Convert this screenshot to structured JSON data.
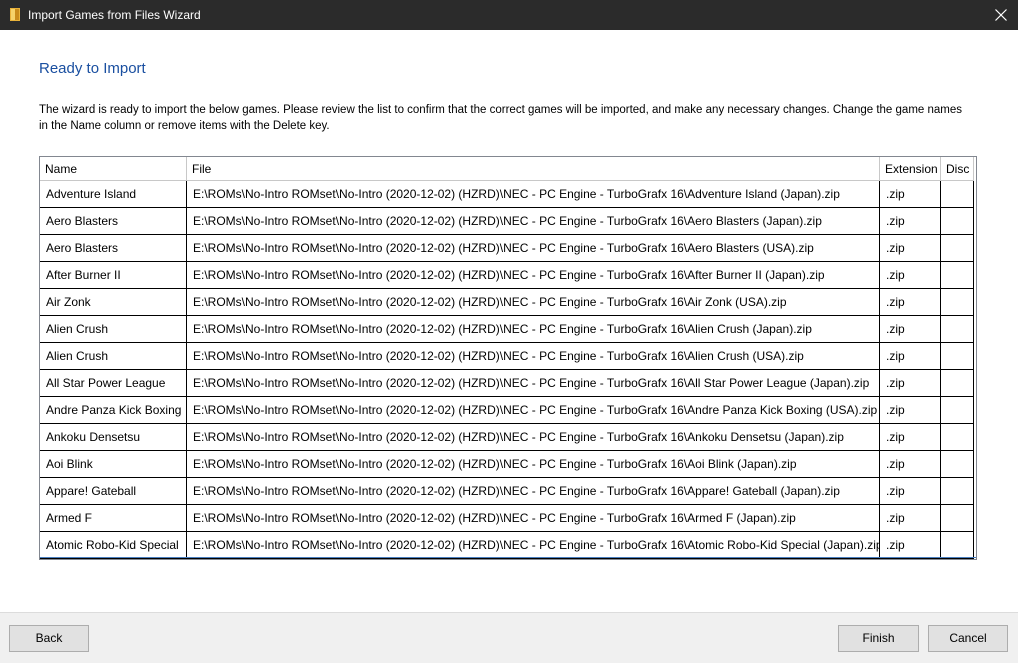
{
  "window": {
    "title": "Import Games from Files Wizard",
    "icon": "folder-icon",
    "close_icon": "close-icon"
  },
  "page": {
    "heading": "Ready to Import",
    "instructions": "The wizard is ready to import the below games. Please review the list to confirm that the correct games will be imported, and make any necessary changes. Change the game names in the Name column or remove items with the Delete key."
  },
  "table": {
    "columns": [
      "Name",
      "File",
      "Extension",
      "Disc"
    ],
    "rows": [
      {
        "name": "Adventure Island",
        "file": "E:\\ROMs\\No-Intro ROMset\\No-Intro (2020-12-02) (HZRD)\\NEC - PC Engine - TurboGrafx 16\\Adventure Island (Japan).zip",
        "ext": ".zip",
        "disc": ""
      },
      {
        "name": "Aero Blasters",
        "file": "E:\\ROMs\\No-Intro ROMset\\No-Intro (2020-12-02) (HZRD)\\NEC - PC Engine - TurboGrafx 16\\Aero Blasters (Japan).zip",
        "ext": ".zip",
        "disc": ""
      },
      {
        "name": "Aero Blasters",
        "file": "E:\\ROMs\\No-Intro ROMset\\No-Intro (2020-12-02) (HZRD)\\NEC - PC Engine - TurboGrafx 16\\Aero Blasters (USA).zip",
        "ext": ".zip",
        "disc": ""
      },
      {
        "name": "After Burner II",
        "file": "E:\\ROMs\\No-Intro ROMset\\No-Intro (2020-12-02) (HZRD)\\NEC - PC Engine - TurboGrafx 16\\After Burner II (Japan).zip",
        "ext": ".zip",
        "disc": ""
      },
      {
        "name": "Air Zonk",
        "file": "E:\\ROMs\\No-Intro ROMset\\No-Intro (2020-12-02) (HZRD)\\NEC - PC Engine - TurboGrafx 16\\Air Zonk (USA).zip",
        "ext": ".zip",
        "disc": ""
      },
      {
        "name": "Alien Crush",
        "file": "E:\\ROMs\\No-Intro ROMset\\No-Intro (2020-12-02) (HZRD)\\NEC - PC Engine - TurboGrafx 16\\Alien Crush (Japan).zip",
        "ext": ".zip",
        "disc": ""
      },
      {
        "name": "Alien Crush",
        "file": "E:\\ROMs\\No-Intro ROMset\\No-Intro (2020-12-02) (HZRD)\\NEC - PC Engine - TurboGrafx 16\\Alien Crush (USA).zip",
        "ext": ".zip",
        "disc": ""
      },
      {
        "name": "All Star Power League",
        "file": "E:\\ROMs\\No-Intro ROMset\\No-Intro (2020-12-02) (HZRD)\\NEC - PC Engine - TurboGrafx 16\\All Star Power League (Japan).zip",
        "ext": ".zip",
        "disc": ""
      },
      {
        "name": "Andre Panza Kick Boxing",
        "file": "E:\\ROMs\\No-Intro ROMset\\No-Intro (2020-12-02) (HZRD)\\NEC - PC Engine - TurboGrafx 16\\Andre Panza Kick Boxing (USA).zip",
        "ext": ".zip",
        "disc": ""
      },
      {
        "name": "Ankoku Densetsu",
        "file": "E:\\ROMs\\No-Intro ROMset\\No-Intro (2020-12-02) (HZRD)\\NEC - PC Engine - TurboGrafx 16\\Ankoku Densetsu (Japan).zip",
        "ext": ".zip",
        "disc": ""
      },
      {
        "name": "Aoi Blink",
        "file": "E:\\ROMs\\No-Intro ROMset\\No-Intro (2020-12-02) (HZRD)\\NEC - PC Engine - TurboGrafx 16\\Aoi Blink (Japan).zip",
        "ext": ".zip",
        "disc": ""
      },
      {
        "name": "Appare! Gateball",
        "file": "E:\\ROMs\\No-Intro ROMset\\No-Intro (2020-12-02) (HZRD)\\NEC - PC Engine - TurboGrafx 16\\Appare! Gateball (Japan).zip",
        "ext": ".zip",
        "disc": ""
      },
      {
        "name": "Armed F",
        "file": "E:\\ROMs\\No-Intro ROMset\\No-Intro (2020-12-02) (HZRD)\\NEC - PC Engine - TurboGrafx 16\\Armed F (Japan).zip",
        "ext": ".zip",
        "disc": ""
      },
      {
        "name": "Atomic Robo-Kid Special",
        "file": "E:\\ROMs\\No-Intro ROMset\\No-Intro (2020-12-02) (HZRD)\\NEC - PC Engine - TurboGrafx 16\\Atomic Robo-Kid Special (Japan).zip",
        "ext": ".zip",
        "disc": ""
      }
    ]
  },
  "footer": {
    "back_label": "Back",
    "finish_label": "Finish",
    "cancel_label": "Cancel"
  },
  "colors": {
    "titlebar": "#2b2b2b",
    "heading": "#1a4fa0",
    "footer_bg": "#f0f0f0"
  }
}
